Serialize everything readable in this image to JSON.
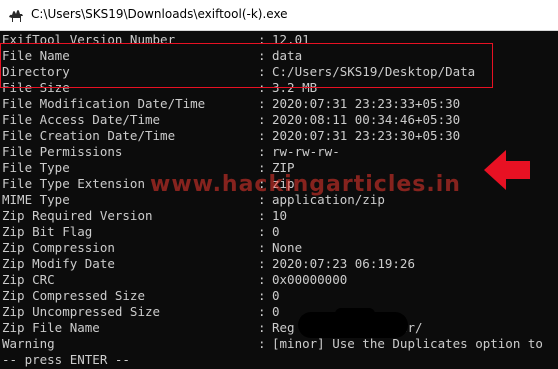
{
  "window": {
    "title": "C:\\Users\\SKS19\\Downloads\\exiftool(-k).exe",
    "icon": "camel-icon"
  },
  "colors": {
    "highlight": "#e81123",
    "arrow": "#e81123",
    "watermark": "#ff3b30"
  },
  "watermark": "www.hackingarticles.in",
  "rows": [
    {
      "key": "ExifTool Version Number",
      "value": "12.01"
    },
    {
      "key": "File Name",
      "value": "data"
    },
    {
      "key": "Directory",
      "value": "C:/Users/SKS19/Desktop/Data"
    },
    {
      "key": "File Size",
      "value": "3.2 MB"
    },
    {
      "key": "File Modification Date/Time",
      "value": "2020:07:31 23:23:33+05:30"
    },
    {
      "key": "File Access Date/Time",
      "value": "2020:08:11 00:34:46+05:30"
    },
    {
      "key": "File Creation Date/Time",
      "value": "2020:07:31 23:23:30+05:30"
    },
    {
      "key": "File Permissions",
      "value": "rw-rw-rw-"
    },
    {
      "key": "File Type",
      "value": "ZIP"
    },
    {
      "key": "File Type Extension",
      "value": "zip"
    },
    {
      "key": "MIME Type",
      "value": "application/zip"
    },
    {
      "key": "Zip Required Version",
      "value": "10"
    },
    {
      "key": "Zip Bit Flag",
      "value": "0"
    },
    {
      "key": "Zip Compression",
      "value": "None"
    },
    {
      "key": "Zip Modify Date",
      "value": "2020:07:23 06:19:26"
    },
    {
      "key": "Zip CRC",
      "value": "0x00000000"
    },
    {
      "key": "Zip Compressed Size",
      "value": "0"
    },
    {
      "key": "Zip Uncompressed Size",
      "value": "0"
    },
    {
      "key": "Zip File Name",
      "value": "Reg          master/"
    },
    {
      "key": "Warning",
      "value": "[minor] Use the Duplicates option to"
    }
  ],
  "separator": ":",
  "footer": "-- press ENTER --"
}
